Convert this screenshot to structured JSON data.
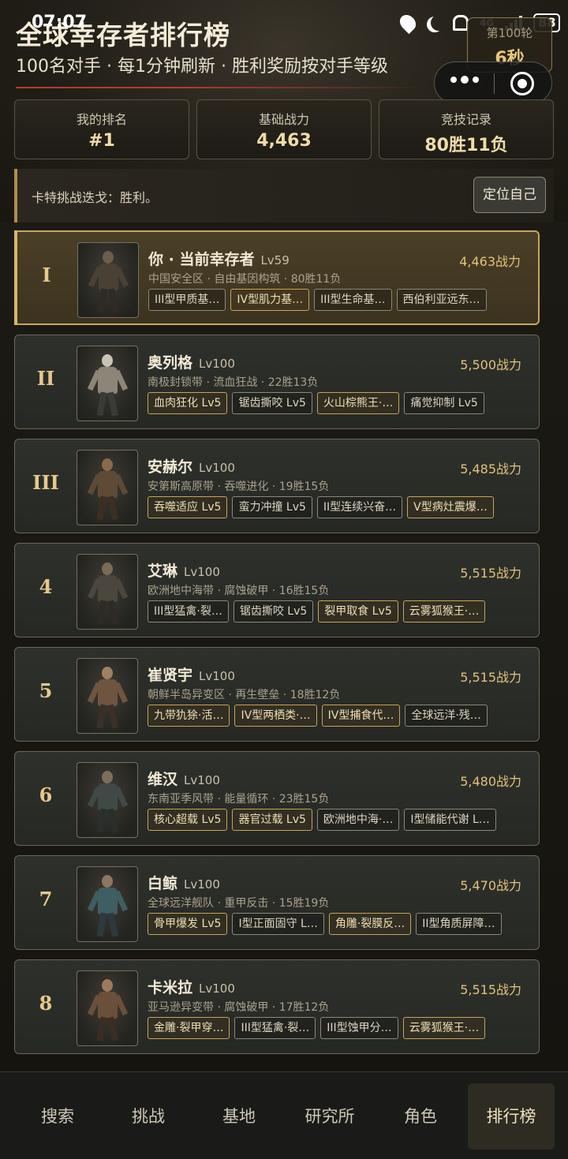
{
  "status_bar": {
    "time": "07:07",
    "network": "4G",
    "battery": "88"
  },
  "header": {
    "title": "全球幸存者排行榜",
    "subtitle": "100名对手 · 每1分钟刷新 · 胜利奖励按对手等级",
    "round_label": "第100轮",
    "round_countdown": "6秒"
  },
  "stats": [
    {
      "label": "我的排名",
      "value": "#1"
    },
    {
      "label": "基础战力",
      "value": "4,463"
    },
    {
      "label": "竞技记录",
      "value": "80胜11负"
    }
  ],
  "notice": {
    "text": "卡特挑战迭戈：胜利。",
    "locate_button": "定位自己"
  },
  "leaderboard": [
    {
      "rank": "I",
      "name": "你 · 当前幸存者",
      "level": "Lv59",
      "power": "4,463战力",
      "info": "中国安全区 · 自由基因构筑 · 80胜11负",
      "me": true,
      "tags": [
        {
          "text": "III型甲质基…",
          "gold": false
        },
        {
          "text": "IV型肌力基…",
          "gold": true
        },
        {
          "text": "III型生命基…",
          "gold": false
        },
        {
          "text": "西伯利亚远东…",
          "gold": false
        }
      ]
    },
    {
      "rank": "II",
      "name": "奥列格",
      "level": "Lv100",
      "power": "5,500战力",
      "info": "南极封锁带 · 流血狂战 · 22胜13负",
      "me": false,
      "tags": [
        {
          "text": "血肉狂化 Lv5",
          "gold": true
        },
        {
          "text": "锯齿撕咬 Lv5",
          "gold": false
        },
        {
          "text": "火山棕熊王·…",
          "gold": true
        },
        {
          "text": "痛觉抑制 Lv5",
          "gold": false
        }
      ]
    },
    {
      "rank": "III",
      "name": "安赫尔",
      "level": "Lv100",
      "power": "5,485战力",
      "info": "安第斯高原带 · 吞噬进化 · 19胜15负",
      "me": false,
      "tags": [
        {
          "text": "吞噬适应 Lv5",
          "gold": true
        },
        {
          "text": "蛮力冲撞 Lv5",
          "gold": false
        },
        {
          "text": "II型连续兴奋…",
          "gold": false
        },
        {
          "text": "V型病灶震爆…",
          "gold": true
        }
      ]
    },
    {
      "rank": "4",
      "name": "艾琳",
      "level": "Lv100",
      "power": "5,515战力",
      "info": "欧洲地中海带 · 腐蚀破甲 · 16胜15负",
      "me": false,
      "tags": [
        {
          "text": "III型猛禽·裂…",
          "gold": false
        },
        {
          "text": "锯齿撕咬 Lv5",
          "gold": false
        },
        {
          "text": "裂甲取食 Lv5",
          "gold": true
        },
        {
          "text": "云雾狐猴王·…",
          "gold": true
        }
      ]
    },
    {
      "rank": "5",
      "name": "崔贤宇",
      "level": "Lv100",
      "power": "5,515战力",
      "info": "朝鲜半岛异变区 · 再生壁垒 · 18胜12负",
      "me": false,
      "tags": [
        {
          "text": "九带犰狳·活…",
          "gold": true
        },
        {
          "text": "IV型两栖类·…",
          "gold": true
        },
        {
          "text": "IV型捕食代…",
          "gold": true
        },
        {
          "text": "全球远洋·残…",
          "gold": false
        }
      ]
    },
    {
      "rank": "6",
      "name": "维汉",
      "level": "Lv100",
      "power": "5,480战力",
      "info": "东南亚季风带 · 能量循环 · 23胜15负",
      "me": false,
      "tags": [
        {
          "text": "核心超载 Lv5",
          "gold": true
        },
        {
          "text": "器官过载 Lv5",
          "gold": true
        },
        {
          "text": "欧洲地中海·…",
          "gold": false
        },
        {
          "text": "I型储能代谢 L…",
          "gold": false
        }
      ]
    },
    {
      "rank": "7",
      "name": "白鲸",
      "level": "Lv100",
      "power": "5,470战力",
      "info": "全球远洋舰队 · 重甲反击 · 15胜19负",
      "me": false,
      "tags": [
        {
          "text": "骨甲爆发 Lv5",
          "gold": true
        },
        {
          "text": "I型正面固守 L…",
          "gold": false
        },
        {
          "text": "角雕·裂膜反…",
          "gold": true
        },
        {
          "text": "II型角质屏障…",
          "gold": false
        }
      ]
    },
    {
      "rank": "8",
      "name": "卡米拉",
      "level": "Lv100",
      "power": "5,515战力",
      "info": "亚马逊异变带 · 腐蚀破甲 · 17胜12负",
      "me": false,
      "tags": [
        {
          "text": "金雕·裂甲穿…",
          "gold": true
        },
        {
          "text": "III型猛禽·裂…",
          "gold": false
        },
        {
          "text": "III型蚀甲分…",
          "gold": false
        },
        {
          "text": "云雾狐猴王·…",
          "gold": true
        }
      ]
    }
  ],
  "bottom_nav": [
    {
      "label": "搜索",
      "active": false
    },
    {
      "label": "挑战",
      "active": false
    },
    {
      "label": "基地",
      "active": false
    },
    {
      "label": "研究所",
      "active": false
    },
    {
      "label": "角色",
      "active": false
    },
    {
      "label": "排行榜",
      "active": true
    }
  ],
  "colors": {
    "accent_gold": "#e2c27a",
    "highlight_border": "#c9a55e",
    "divider_red": "#b33a2e"
  }
}
